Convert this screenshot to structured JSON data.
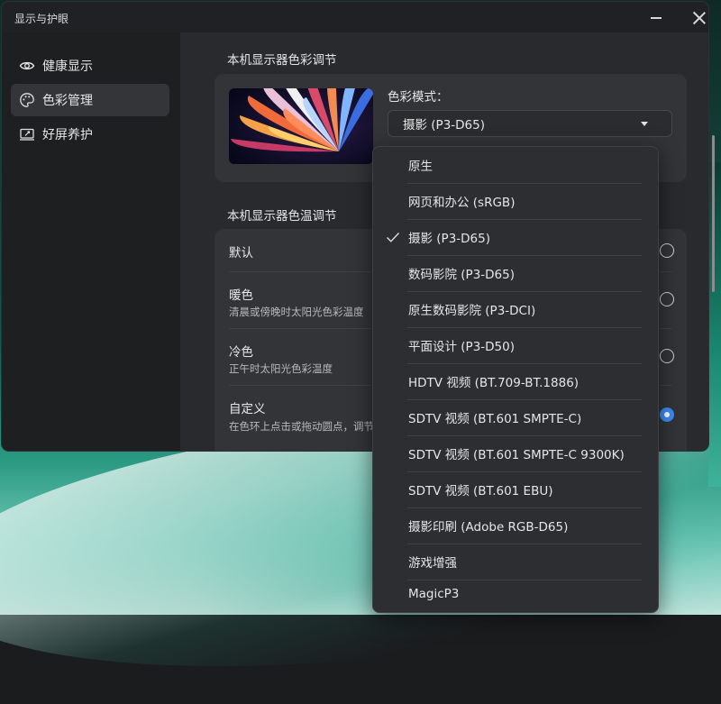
{
  "window": {
    "title": "显示与护眼"
  },
  "sidebar": {
    "items": [
      {
        "label": "健康显示",
        "icon": "eye-icon",
        "active": false
      },
      {
        "label": "色彩管理",
        "icon": "palette-icon",
        "active": true
      },
      {
        "label": "好屏养护",
        "icon": "screen-care-icon",
        "active": false
      }
    ]
  },
  "main": {
    "color_section_title": "本机显示器色彩调节",
    "color_mode_label": "色彩模式：",
    "color_mode_selected": "摄影 (P3-D65)",
    "temp_section_title": "本机显示器色温调节",
    "temp_options": [
      {
        "title": "默认",
        "desc": "",
        "checked": false
      },
      {
        "title": "暖色",
        "desc": "清晨或傍晚时太阳光色彩温度",
        "checked": false
      },
      {
        "title": "冷色",
        "desc": "正午时太阳光色彩温度",
        "checked": false
      },
      {
        "title": "自定义",
        "desc": "在色环上点击或拖动圆点，调节",
        "checked": true
      }
    ]
  },
  "dropdown": {
    "options": [
      "原生",
      "网页和办公 (sRGB)",
      "摄影 (P3-D65)",
      "数码影院 (P3-D65)",
      "原生数码影院 (P3-DCI)",
      "平面设计 (P3-D50)",
      "HDTV 视频 (BT.709-BT.1886)",
      "SDTV 视频 (BT.601 SMPTE-C)",
      "SDTV 视频 (BT.601 SMPTE-C 9300K)",
      "SDTV 视频 (BT.601 EBU)",
      "摄影印刷 (Adobe RGB-D65)",
      "游戏增强",
      "MagicP3"
    ],
    "selected_index": 2
  },
  "colors": {
    "accent": "#3c8cf6",
    "window_bg": "#202124",
    "card_bg": "#323438"
  }
}
